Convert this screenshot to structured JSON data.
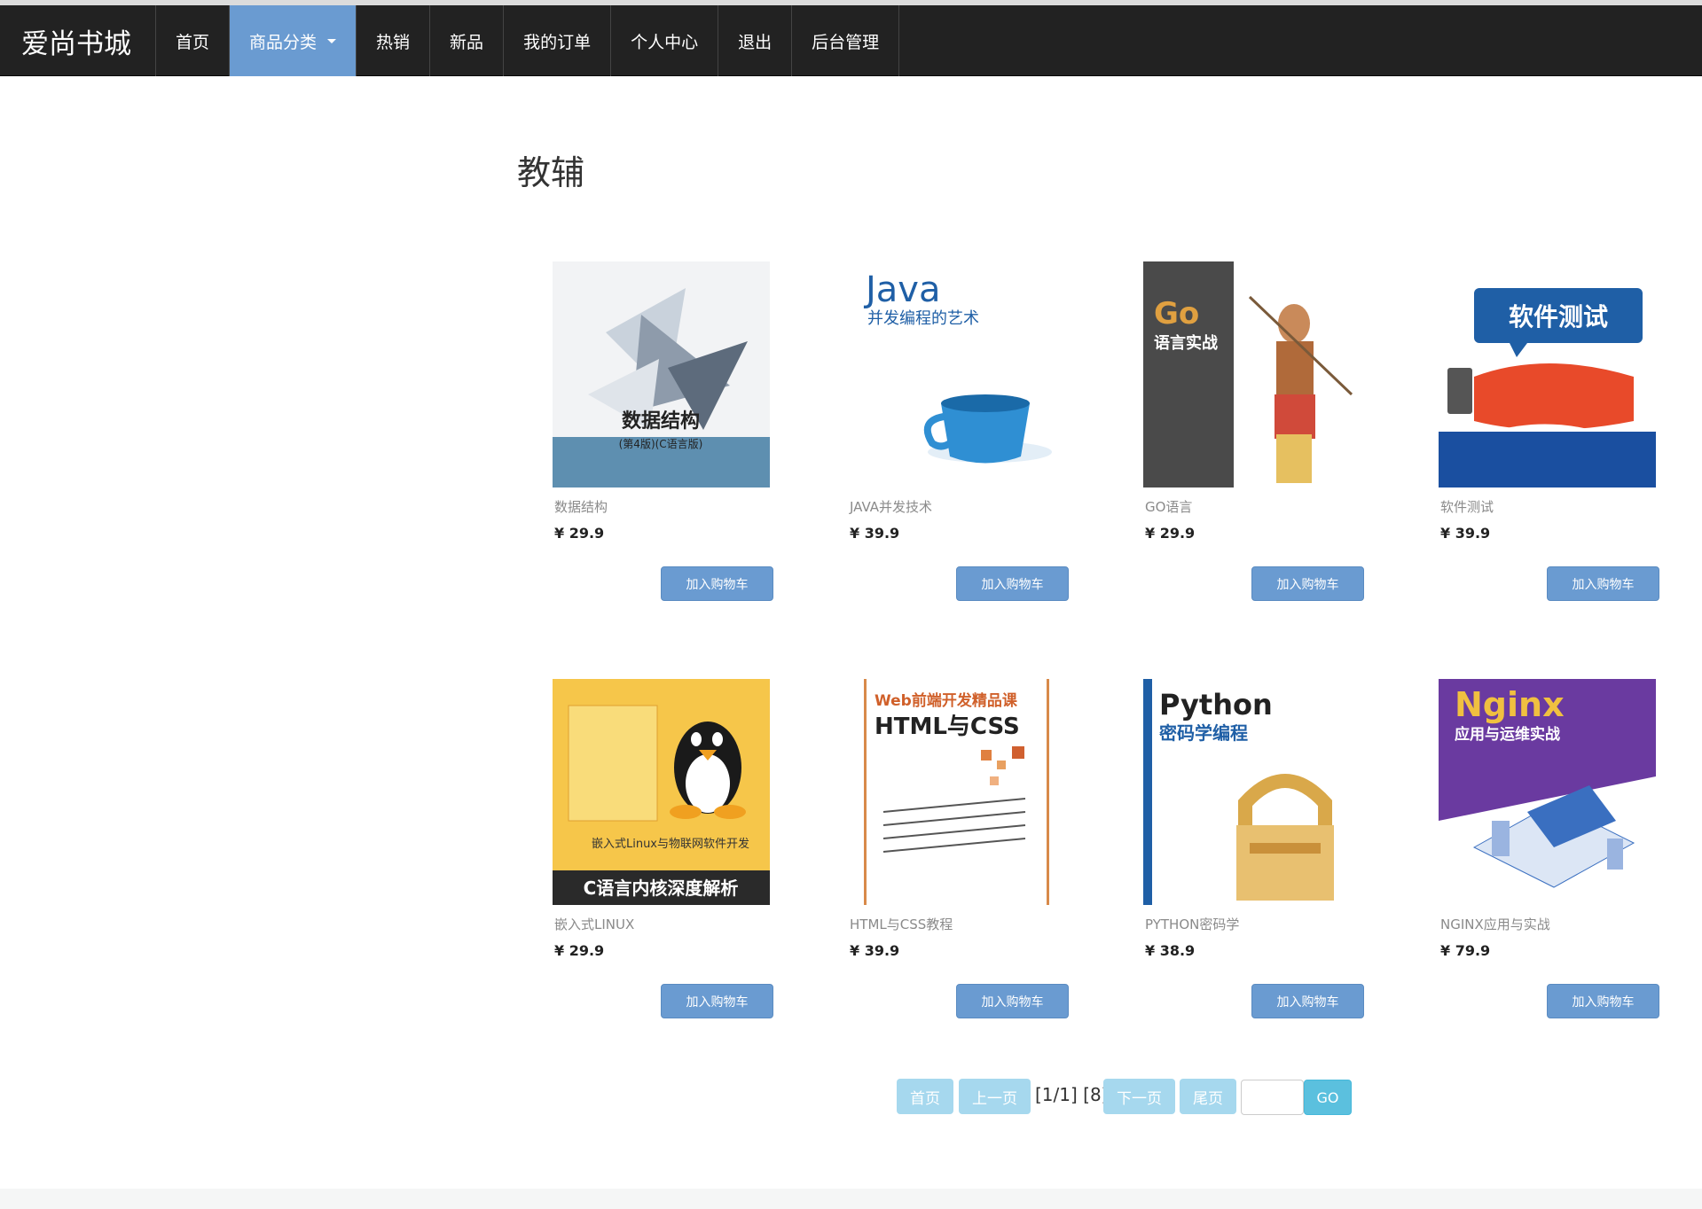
{
  "nav": {
    "brand": "爱尚书城",
    "items": [
      {
        "label": "首页"
      },
      {
        "label": "商品分类"
      },
      {
        "label": "热销"
      },
      {
        "label": "新品"
      },
      {
        "label": "我的订单"
      },
      {
        "label": "个人中心"
      },
      {
        "label": "退出"
      },
      {
        "label": "后台管理"
      }
    ],
    "active_color": "#6a9bd1"
  },
  "page": {
    "title": "教辅"
  },
  "books": [
    {
      "name": "数据结构",
      "price": "¥ 29.9",
      "button": "加入购物车",
      "cover_title": "数据结构",
      "cover_sub": "(第4版)(C语言版)"
    },
    {
      "name": "JAVA并发技术",
      "price": "¥ 39.9",
      "button": "加入购物车",
      "cover_title": "Java",
      "cover_sub": "并发编程的艺术"
    },
    {
      "name": "GO语言",
      "price": "¥ 29.9",
      "button": "加入购物车",
      "cover_title": "Go",
      "cover_sub": "语言实战"
    },
    {
      "name": "软件测试",
      "price": "¥ 39.9",
      "button": "加入购物车",
      "cover_title": "软件测试",
      "cover_sub": ""
    },
    {
      "name": "嵌入式LINUX",
      "price": "¥ 29.9",
      "button": "加入购物车",
      "cover_title": "C语言内核深度解析",
      "cover_sub": "嵌入式Linux与物联网软件开发"
    },
    {
      "name": "HTML与CSS教程",
      "price": "¥ 39.9",
      "button": "加入购物车",
      "cover_title": "HTML与CSS",
      "cover_sub": "Web前端开发精品课"
    },
    {
      "name": "PYTHON密码学",
      "price": "¥ 38.9",
      "button": "加入购物车",
      "cover_title": "Python",
      "cover_sub": "密码学编程"
    },
    {
      "name": "NGINX应用与实战",
      "price": "¥ 79.9",
      "button": "加入购物车",
      "cover_title": "Nginx",
      "cover_sub": "应用与运维实战"
    }
  ],
  "pagination": {
    "first": "首页",
    "prev": "上一页",
    "info": "[1/1] [8]",
    "next": "下一页",
    "last": "尾页",
    "input_value": "",
    "go": "GO"
  }
}
